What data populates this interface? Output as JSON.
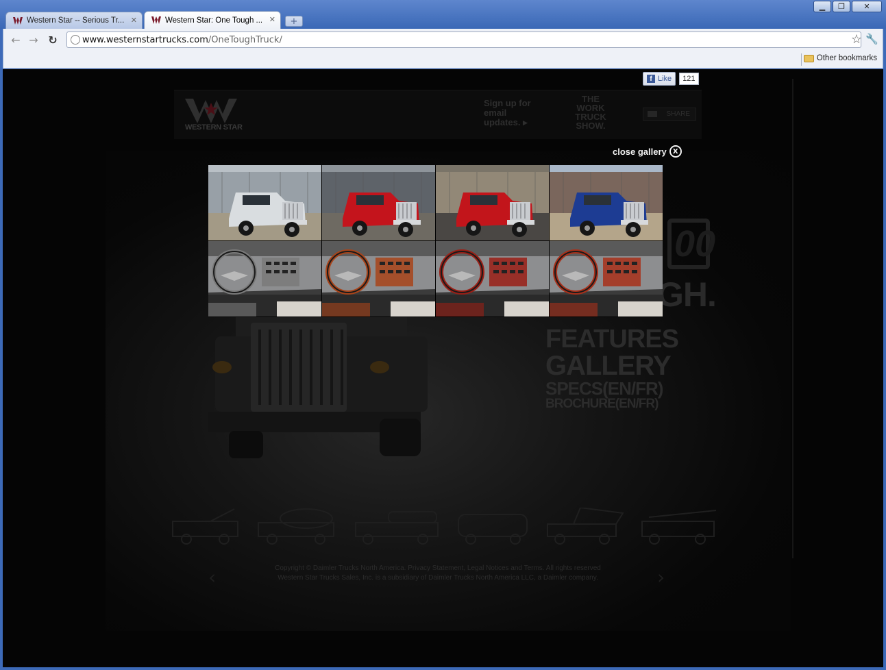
{
  "browser": {
    "tabs": [
      {
        "title": "Western Star -- Serious Tr...",
        "active": false
      },
      {
        "title": "Western Star: One Tough ...",
        "active": true
      }
    ],
    "address": {
      "host": "www.westernstartrucks.com",
      "path": "/OneToughTruck/"
    },
    "bookmarks": {
      "other_label": "Other bookmarks"
    }
  },
  "page": {
    "facebook": {
      "like_label": "Like",
      "like_count": "121"
    },
    "header": {
      "logo_text": "WESTERN STAR",
      "signup_text": "Sign up for email updates. ▸",
      "work_truck_show": "THE WORK TRUCK SHOW.",
      "share_label": "SHARE"
    },
    "headline_top": "00",
    "headline_bottom": "GH.",
    "menu": {
      "features": "FEATURES",
      "gallery": "GALLERY",
      "specs": "SPECS(EN/FR)",
      "brochure": "BROCHURE(EN/FR)"
    },
    "footer": {
      "line1": "Copyright © Daimler Trucks North America. Privacy Statement, Legal Notices and Terms. All rights reserved",
      "line2": "Western Star Trucks Sales, Inc. is a subsidiary of Daimler Trucks North America LLC, a Daimler company."
    },
    "gallery": {
      "close_label": "close gallery",
      "close_symbol": "X",
      "thumbs": [
        {
          "kind": "exterior",
          "truck_color": "#d9dde0",
          "scene": "warehouse"
        },
        {
          "kind": "exterior",
          "truck_color": "#c4141c",
          "scene": "steel-frame"
        },
        {
          "kind": "exterior",
          "truck_color": "#c2151b",
          "scene": "brick-wall"
        },
        {
          "kind": "exterior",
          "truck_color": "#1d3c93",
          "scene": "construction"
        },
        {
          "kind": "interior",
          "trim_color": "#7a7a7a"
        },
        {
          "kind": "interior",
          "trim_color": "#a8441a"
        },
        {
          "kind": "interior",
          "trim_color": "#9a1f16"
        },
        {
          "kind": "interior",
          "trim_color": "#a8301a"
        }
      ]
    }
  }
}
